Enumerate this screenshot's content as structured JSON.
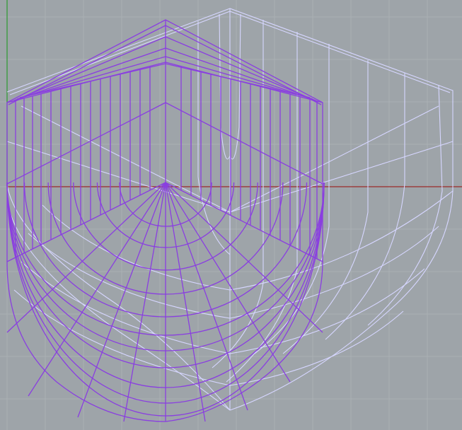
{
  "viewport": {
    "background": "#9ea4a9",
    "grid_color": "#aab0b4",
    "x_axis_color": "#9c2a2a",
    "y_axis_color": "#2c9a30"
  },
  "ghost_object": {
    "color": "#d6d6ff",
    "state": "unselected wireframe"
  },
  "selected_object": {
    "color": "#8a3fe0",
    "state": "selected wireframe"
  }
}
